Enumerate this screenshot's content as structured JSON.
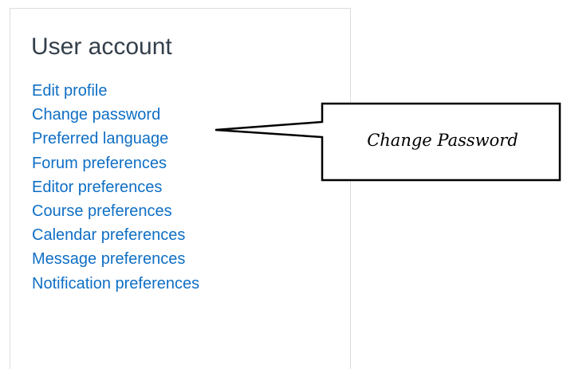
{
  "user_account": {
    "title": "User account",
    "links": [
      {
        "label": "Edit profile"
      },
      {
        "label": "Change password"
      },
      {
        "label": "Preferred language"
      },
      {
        "label": "Forum preferences"
      },
      {
        "label": "Editor preferences"
      },
      {
        "label": "Course preferences"
      },
      {
        "label": "Calendar preferences"
      },
      {
        "label": "Message preferences"
      },
      {
        "label": "Notification preferences"
      }
    ]
  },
  "callout": {
    "text": "Change Password"
  },
  "colors": {
    "link": "#0f6fc5",
    "title": "#333f4a",
    "panel_border": "#dcdcdc",
    "callout_stroke": "#000000"
  }
}
